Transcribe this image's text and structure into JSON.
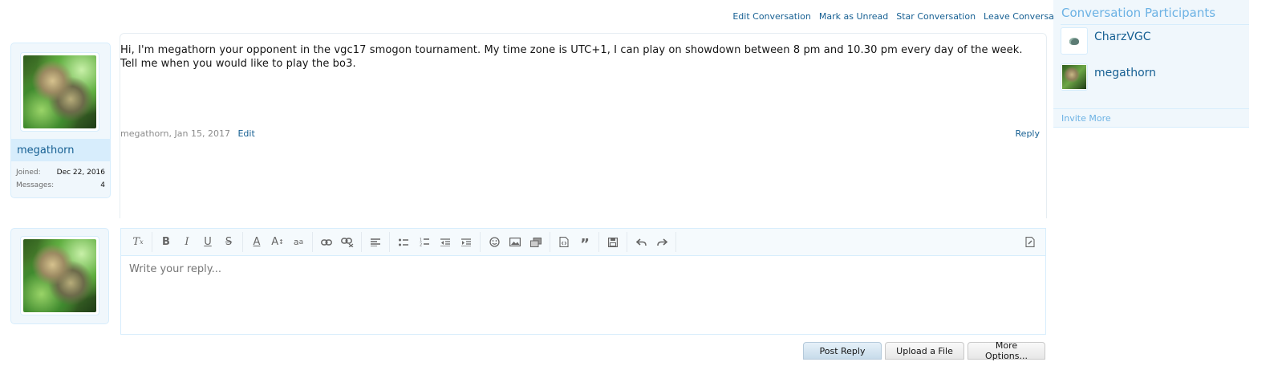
{
  "conversation_actions": {
    "edit": "Edit Conversation",
    "mark_unread": "Mark as Unread",
    "star": "Star Conversation",
    "leave": "Leave Conversation"
  },
  "message": {
    "author": "megathorn",
    "joined_label": "Joined:",
    "joined_value": "Dec 22, 2016",
    "messages_label": "Messages:",
    "messages_value": "4",
    "text_line1": "Hi, I'm megathorn your opponent in the vgc17 smogon tournament. My time zone is UTC+1, I can play on showdown between 8 pm and 10.30 pm every day of the week.",
    "text_line2": "Tell me when you would like to play the bo3.",
    "meta": "megathorn, Jan 15, 2017",
    "edit_label": "Edit",
    "reply_label": "Reply"
  },
  "editor": {
    "placeholder": "Write your reply...",
    "toolbar_icons": [
      "remove-format-icon",
      "bold-icon",
      "italic-icon",
      "underline-icon",
      "strikethrough-icon",
      "text-color-icon",
      "font-size-icon",
      "font-family-icon",
      "link-icon",
      "unlink-icon",
      "align-icon",
      "bullet-list-icon",
      "numbered-list-icon",
      "outdent-icon",
      "indent-icon",
      "smilie-icon",
      "image-icon",
      "media-icon",
      "code-icon",
      "quote-icon",
      "save-draft-icon",
      "undo-icon",
      "redo-icon",
      "toggle-bbcode-icon"
    ]
  },
  "buttons": {
    "post_reply": "Post Reply",
    "upload_file": "Upload a File",
    "more_options": "More Options..."
  },
  "sidebar": {
    "title": "Conversation Participants",
    "participants": [
      {
        "name": "CharzVGC"
      },
      {
        "name": "megathorn"
      }
    ],
    "invite_more": "Invite More"
  }
}
